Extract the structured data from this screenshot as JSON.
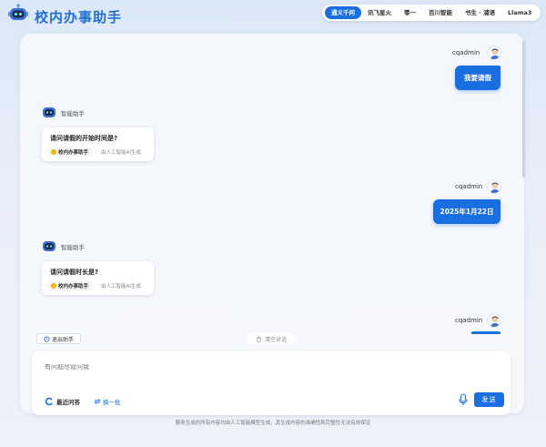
{
  "app": {
    "title": "校内办事助手"
  },
  "model_tabs": [
    {
      "label": "通义千问",
      "active": true
    },
    {
      "label": "讯飞星火",
      "active": false
    },
    {
      "label": "零一",
      "active": false
    },
    {
      "label": "百川智能",
      "active": false
    },
    {
      "label": "书生 · 浦语",
      "active": false
    },
    {
      "label": "Llama3",
      "active": false
    }
  ],
  "messages": [
    {
      "role": "user",
      "name": "cqadmin",
      "text": "我要请假"
    },
    {
      "role": "bot",
      "name": "智能助手",
      "text": "请问请假的开始时间是?",
      "source": "校内办事助手",
      "note": "由人工智能AI生成"
    },
    {
      "role": "user",
      "name": "cqadmin",
      "text": "2025年1月22日"
    },
    {
      "role": "bot",
      "name": "智能助手",
      "text": "请问请假时长是?",
      "source": "校内办事助手",
      "note": "由人工智能AI生成"
    },
    {
      "role": "user",
      "name": "cqadmin",
      "text": ""
    }
  ],
  "actions": {
    "exit_label": "退出助手",
    "clear_label": "清空对话"
  },
  "input": {
    "placeholder": "有问题尽管问我",
    "recent_label": "最近问答",
    "swap_label": "换一批",
    "send_label": "发送"
  },
  "footer": {
    "disclaimer": "服务生成的所有内容均由人工智能模型生成，其生成内容的准确性和完整性无法有效保证"
  },
  "colors": {
    "accent": "#1a6fe0",
    "title": "#1f6fd0"
  }
}
